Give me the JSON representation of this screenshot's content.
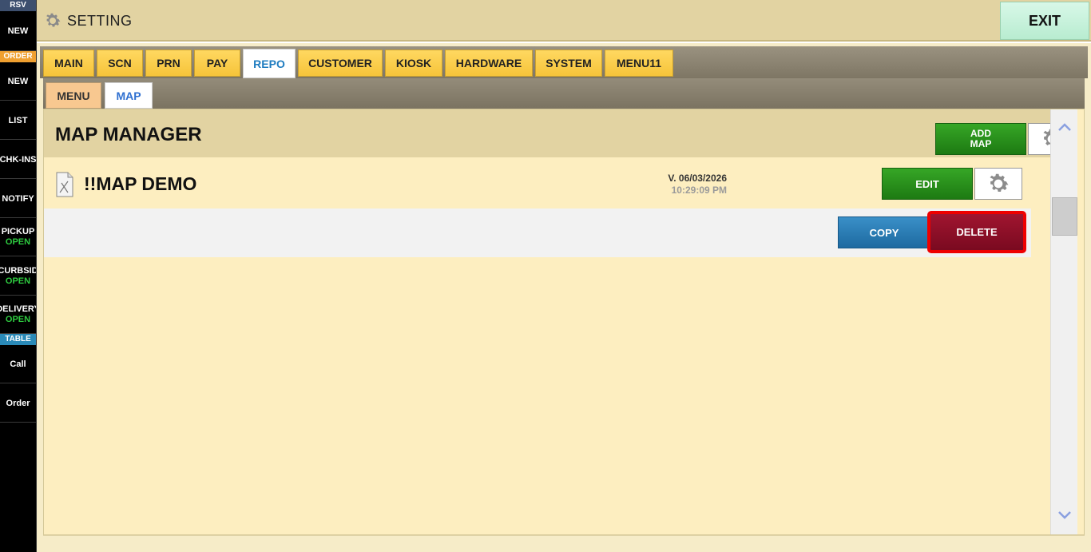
{
  "sidebar": {
    "rsv_header": "RSV",
    "rsv_new": "NEW",
    "order_header": "ORDER",
    "order_new": "NEW",
    "list": "LIST",
    "chk_ins": "CHK-INS",
    "notify": "NOTIFY",
    "pickup": {
      "label": "PICKUP",
      "status": "OPEN"
    },
    "curbside": {
      "label": "CURBSID",
      "status": "OPEN"
    },
    "delivery": {
      "label": "DELIVERY",
      "status": "OPEN"
    },
    "table_header": "TABLE",
    "call": "Call",
    "order": "Order"
  },
  "header": {
    "title": "SETTING",
    "exit_label": "EXIT"
  },
  "tabs": [
    {
      "label": "MAIN",
      "active": false
    },
    {
      "label": "SCN",
      "active": false
    },
    {
      "label": "PRN",
      "active": false
    },
    {
      "label": "PAY",
      "active": false
    },
    {
      "label": "REPO",
      "active": true
    },
    {
      "label": "CUSTOMER",
      "active": false
    },
    {
      "label": "KIOSK",
      "active": false
    },
    {
      "label": "HARDWARE",
      "active": false
    },
    {
      "label": "SYSTEM",
      "active": false
    },
    {
      "label": "MENU11",
      "active": false
    }
  ],
  "subtabs": [
    {
      "label": "MENU",
      "active": false
    },
    {
      "label": "MAP",
      "active": true
    }
  ],
  "panel": {
    "title": "MAP MANAGER",
    "add_map_line1": "ADD",
    "add_map_line2": "MAP"
  },
  "map_item": {
    "name": "!!MAP DEMO",
    "version": "V. 06/03/2026",
    "time": "10:29:09 PM",
    "edit_label": "EDIT",
    "copy_label": "COPY",
    "delete_label": "DELETE"
  },
  "colors": {
    "accent_green": "#1d7a12",
    "delete_red": "#7a0a20",
    "highlight": "#ee0000",
    "copy_blue": "#1d6aa0"
  }
}
